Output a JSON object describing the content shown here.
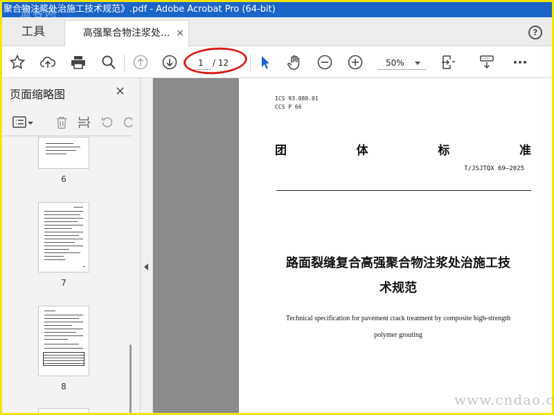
{
  "window": {
    "title": "聚合物注浆处治施工技术规范》.pdf - Adobe Acrobat Pro (64-bit)",
    "watermark_top": "道客网",
    "watermark_bottom": "www.cndao.com",
    "frame_color": "#f5e400",
    "titlebar_color": "#1b64c8"
  },
  "tabs": {
    "tools_label": "工具",
    "doc_tab_label": "高强聚合物注浆处...",
    "doc_tab_close": "×",
    "help": "?"
  },
  "toolbar": {
    "bookmark_icon": "star-icon",
    "upload_icon": "cloud-upload-icon",
    "print_icon": "printer-icon",
    "search_icon": "search-icon",
    "prev_icon": "arrow-up-circle-icon",
    "next_icon": "arrow-down-circle-icon",
    "current_page": "1",
    "total_pages": "/ 12",
    "select_icon": "cursor-icon",
    "hand_icon": "hand-icon",
    "zoom_out_icon": "minus-circle-icon",
    "zoom_in_icon": "plus-circle-icon",
    "zoom_value": "50%",
    "highlight_color": "#d6201c"
  },
  "sidebar": {
    "title": "页面缩略图",
    "close": "×",
    "thumbnails": [
      {
        "label": "6"
      },
      {
        "label": "7"
      },
      {
        "label": "8"
      }
    ]
  },
  "document": {
    "ics_line1": "ICS 93.080.01",
    "ics_line2": "CCS P 66",
    "category_chars": [
      "团",
      "体",
      "标",
      "准"
    ],
    "standard_no": "T/JSJTQX 69—2025",
    "title_zh_line1": "路面裂缝复合高强聚合物注浆处治施工技",
    "title_zh_line2": "术规范",
    "title_en_line1": "Technical specification for pavement crack treatment by composite high-strength",
    "title_en_line2": "polymer grouting"
  }
}
